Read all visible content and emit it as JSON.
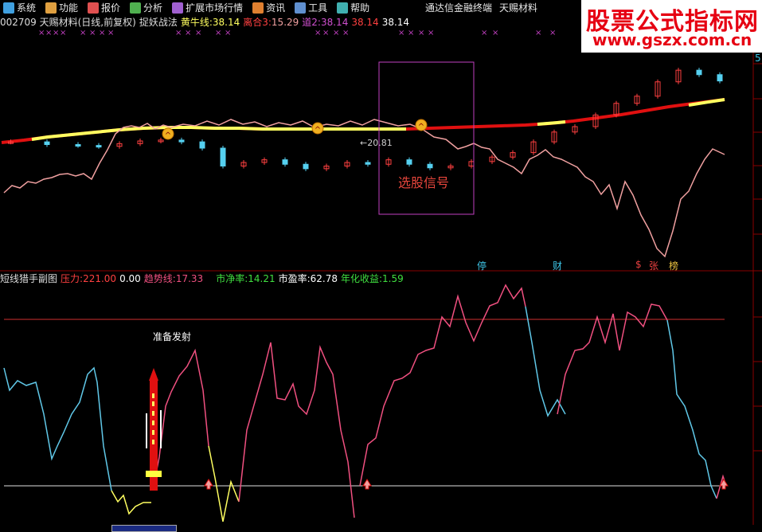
{
  "menu": {
    "items": [
      {
        "label": "系统",
        "icon": "system-icon"
      },
      {
        "label": "功能",
        "icon": "function-icon"
      },
      {
        "label": "报价",
        "icon": "quote-icon"
      },
      {
        "label": "分析",
        "icon": "analysis-icon"
      },
      {
        "label": "扩展市场行情",
        "icon": "extended-market-icon"
      },
      {
        "label": "资讯",
        "icon": "news-icon"
      },
      {
        "label": "工具",
        "icon": "tools-icon"
      },
      {
        "label": "帮助",
        "icon": "help-icon"
      }
    ],
    "terminal_name": "通达信金融终端",
    "stock_name_right": "天赐材料"
  },
  "main_chart": {
    "header": {
      "title": "002709 天赐材料(日线,前复权)",
      "indicator_name": "捉妖战法",
      "bull_line_label": "黄牛线:",
      "bull_line_value": "38.14",
      "separate_label": "离合3:",
      "separate_value": "15.29",
      "dao_label": "道2:",
      "dao_value": "38.14",
      "extra_value_1": "38.14",
      "extra_value_2": "38.14"
    },
    "min_price_label": "20.81",
    "signal_box_label": "选股信号",
    "right_axis_partial": "5",
    "tags": [
      {
        "text": "停",
        "color": "#3ec6e8"
      },
      {
        "text": "财",
        "color": "#3ec6e8"
      },
      {
        "text": "$",
        "color": "#e84040"
      },
      {
        "text": "张",
        "color": "#e84040"
      },
      {
        "text": "榜",
        "color": "#e8c040"
      }
    ]
  },
  "sub_chart": {
    "header": {
      "title": "短线猎手副图",
      "pressure_label": "压力:",
      "pressure_value": "221.00",
      "zero_value": "0.00",
      "trend_label": "趋势线:",
      "trend_value": "17.33",
      "pb_label": "市净率:",
      "pb_value": "14.21",
      "pe_label": "市盈率:",
      "pe_value": "62.78",
      "yield_label": "年化收益:",
      "yield_value": "1.59"
    },
    "fire_label": "准备发射"
  },
  "watermark": {
    "title": "股票公式指标网",
    "url": "www.gszx.com.cn"
  },
  "colors": {
    "background": "#000000",
    "up_candle": "#ff4040",
    "down_candle": "#55d0f0",
    "bull_line_red": "#e01010",
    "bull_line_yellow": "#ffff60",
    "pink_line": "#f0a0a0",
    "signal_box": "#c040c0",
    "grid": "#800000"
  },
  "chart_data": {
    "type": "line",
    "title": "",
    "note_series": [
      {
        "name": "捉妖战法",
        "description": "candlestick price series"
      },
      {
        "name": "短线猎手副图",
        "description": "oscillator"
      }
    ],
    "main_price_points_x": [
      1,
      8,
      14,
      18,
      22,
      26,
      30,
      34,
      38,
      42,
      46,
      50,
      54,
      58,
      62,
      66,
      70,
      74,
      78,
      82,
      86,
      90,
      94,
      98,
      102,
      106,
      110,
      114,
      118,
      122,
      126,
      130,
      134,
      138
    ],
    "main_close_values": [
      33.5,
      33.2,
      33.1,
      33.0,
      33.3,
      33.6,
      33.7,
      33.5,
      32.8,
      30.8,
      31.2,
      31.5,
      31.0,
      30.5,
      30.8,
      31.2,
      31.0,
      31.5,
      31.0,
      30.6,
      30.8,
      31.3,
      31.8,
      32.3,
      33.5,
      34.6,
      35.2,
      36.5,
      37.8,
      38.6,
      40.2,
      41.5,
      41.0,
      40.3
    ],
    "oscillator_values": [
      31,
      30,
      17,
      24,
      28,
      20,
      6,
      5,
      16,
      17,
      18,
      18,
      28,
      32,
      25,
      28,
      6,
      3,
      10,
      21,
      26,
      22,
      25,
      37,
      39,
      36,
      37,
      33,
      28,
      24,
      14,
      9,
      5,
      11
    ]
  }
}
